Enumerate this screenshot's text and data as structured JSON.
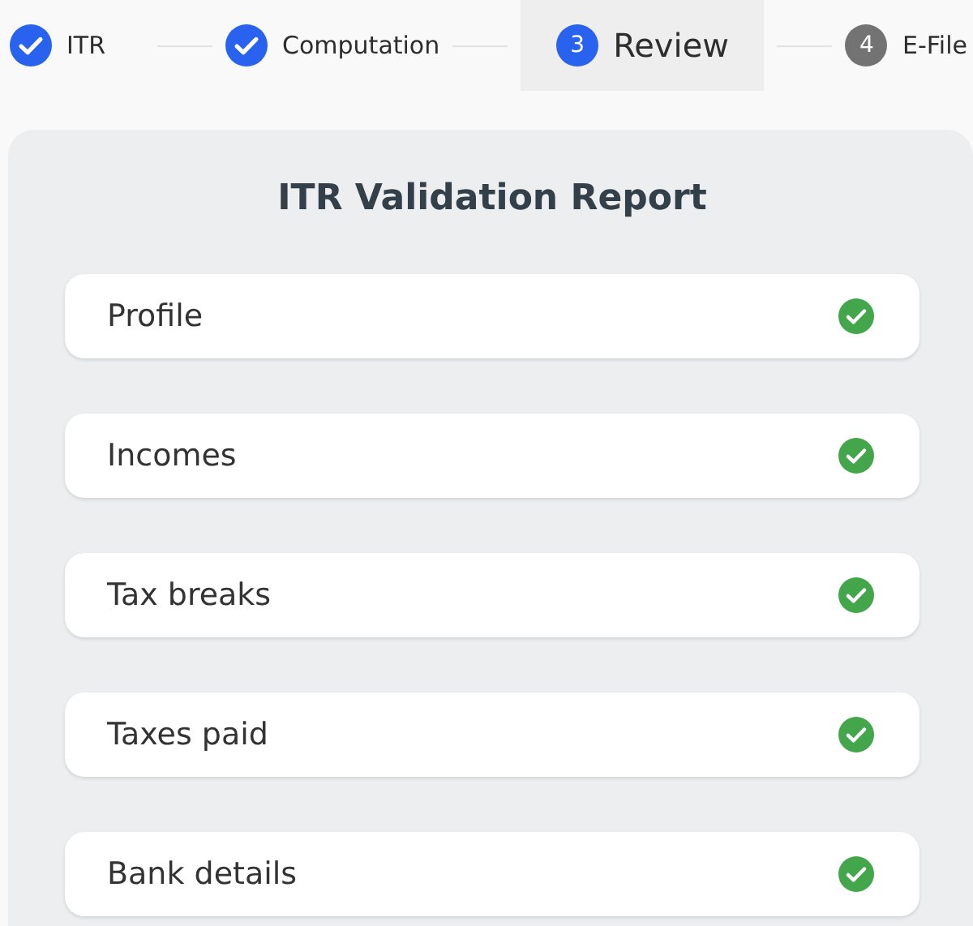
{
  "steps": [
    {
      "label": "ITR",
      "kind": "done",
      "selected": false
    },
    {
      "label": "Computation",
      "kind": "done",
      "selected": false
    },
    {
      "label": "Review",
      "number": "3",
      "kind": "active",
      "selected": true
    },
    {
      "label": "E-File",
      "number": "4",
      "kind": "pending",
      "selected": false
    }
  ],
  "report": {
    "title": "ITR Validation Report",
    "items": [
      {
        "label": "Profile",
        "valid": true
      },
      {
        "label": "Incomes",
        "valid": true
      },
      {
        "label": "Tax breaks",
        "valid": true
      },
      {
        "label": "Taxes paid",
        "valid": true
      },
      {
        "label": "Bank details",
        "valid": true
      }
    ]
  }
}
